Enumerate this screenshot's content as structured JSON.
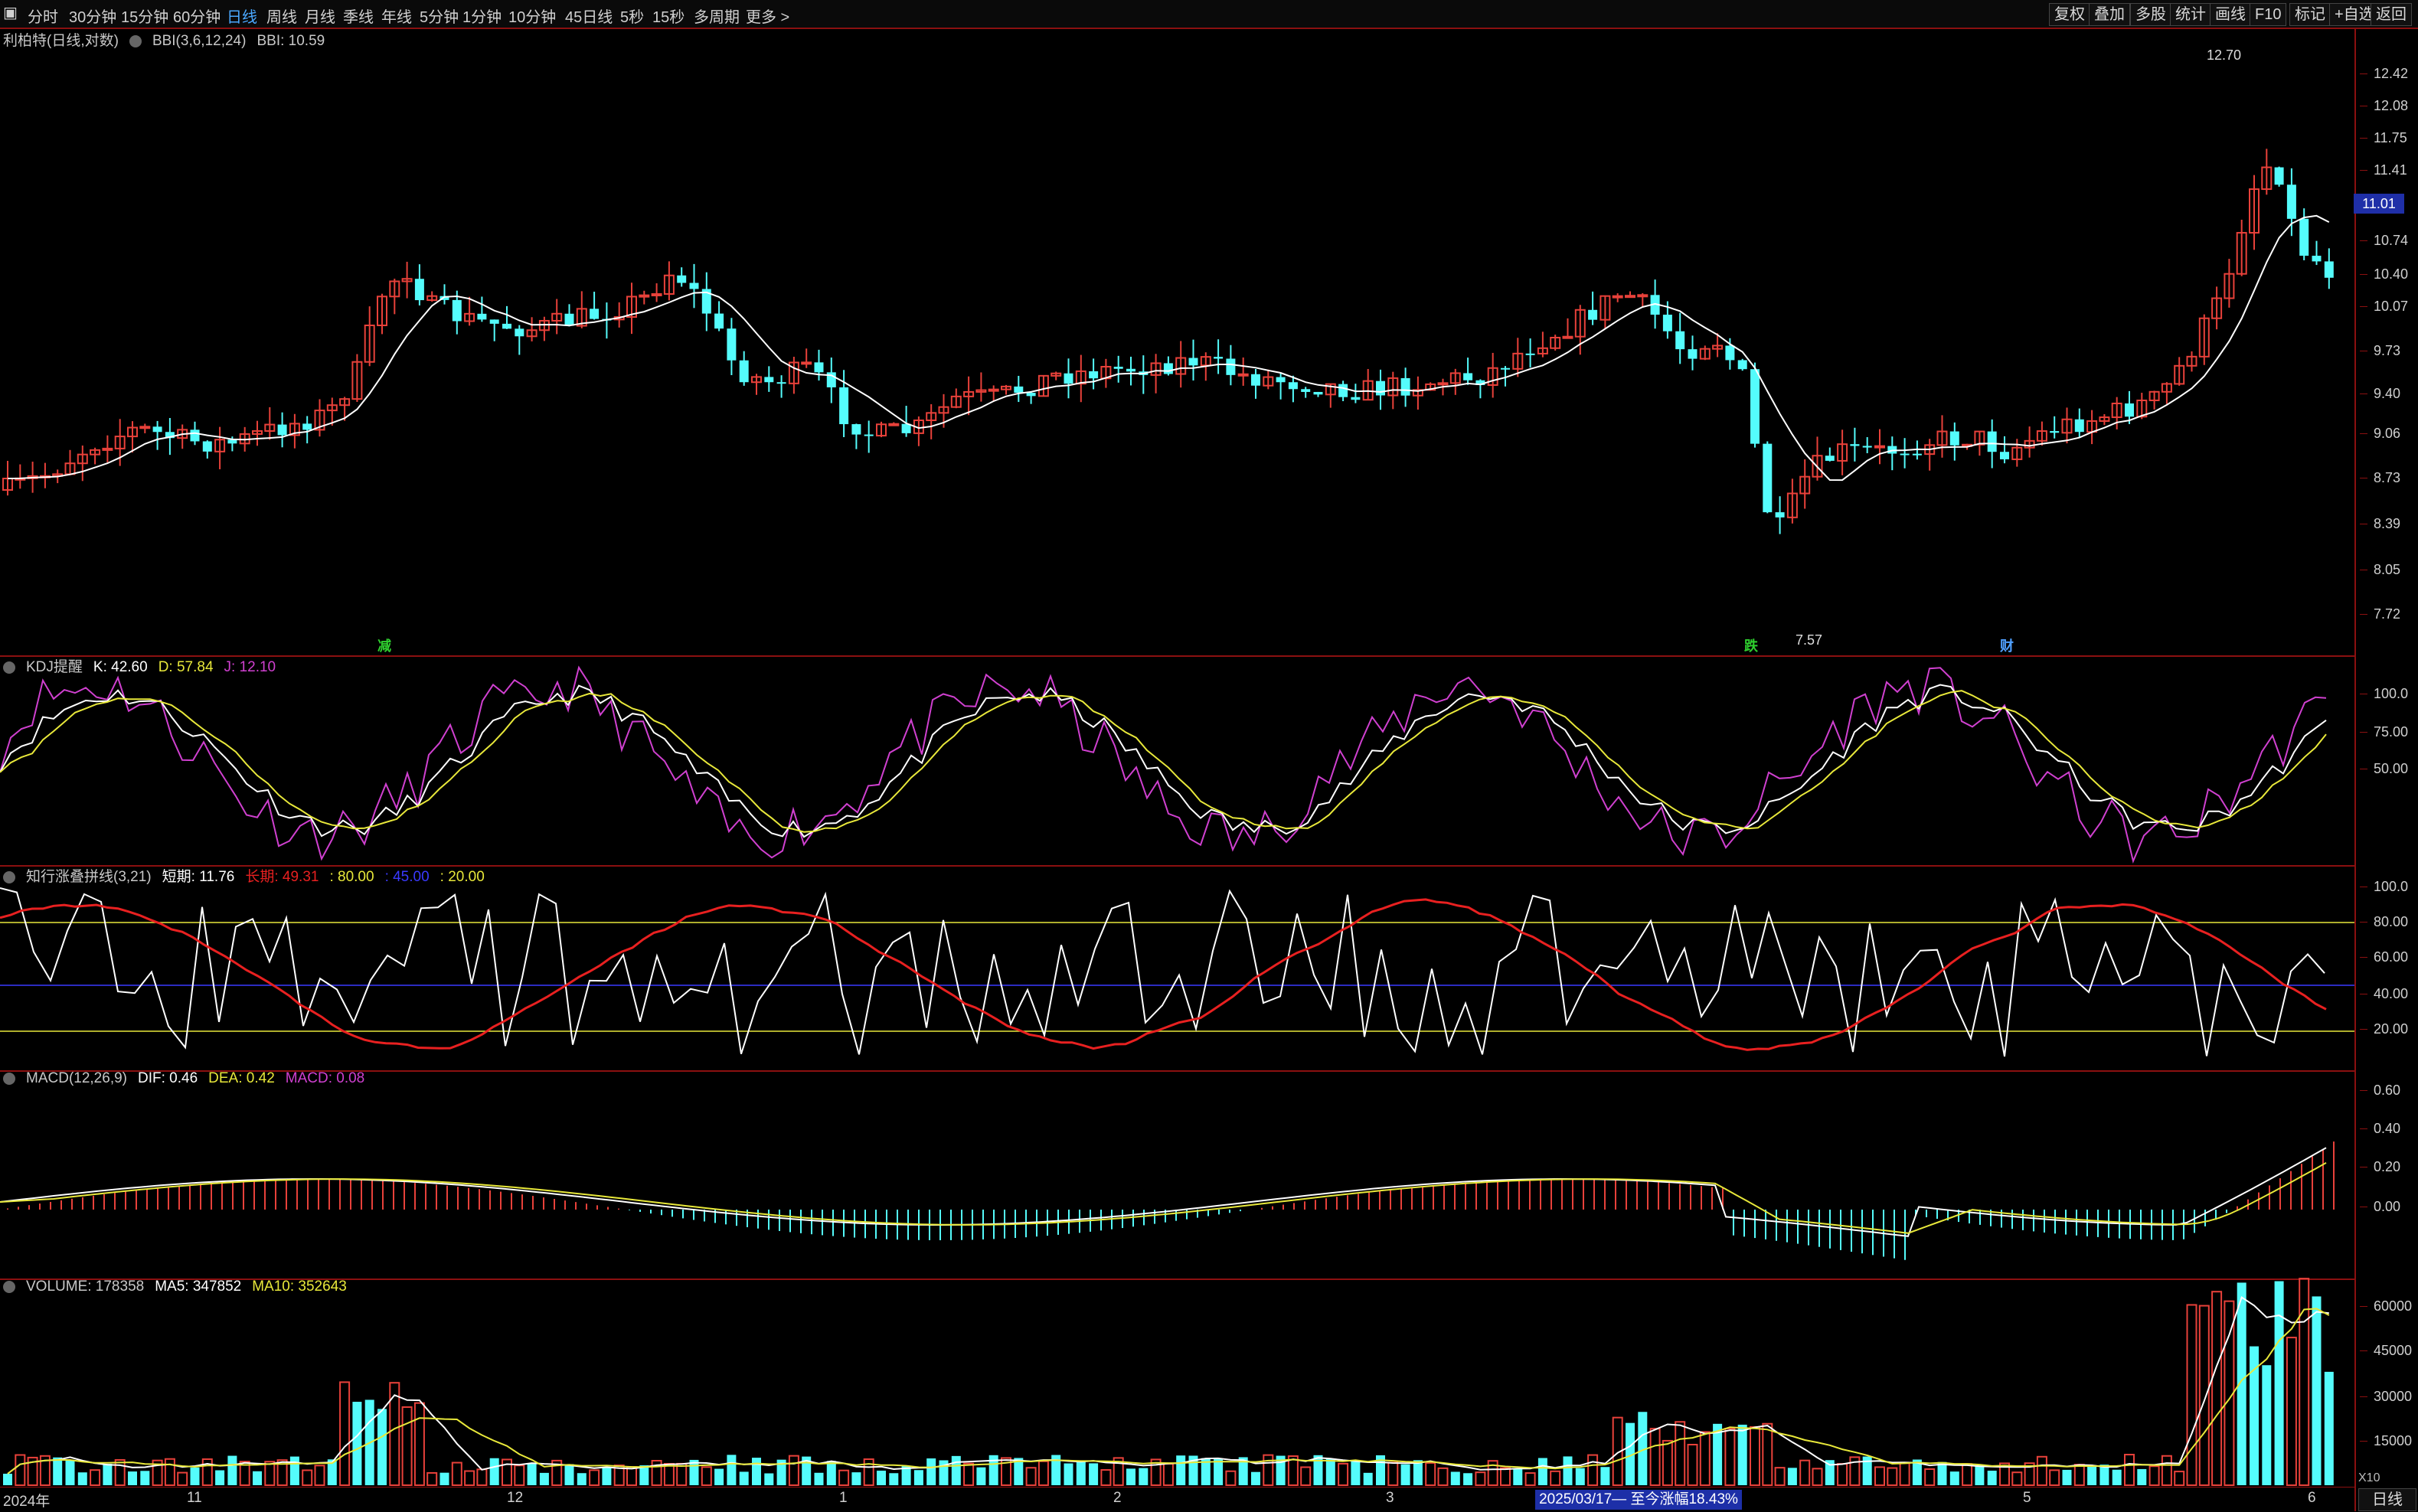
{
  "toolbar": {
    "periods": [
      "分时",
      "30分钟",
      "15分钟",
      "60分钟",
      "日线",
      "周线",
      "月线",
      "季线",
      "年线",
      "5分钟",
      "1分钟",
      "10分钟",
      "45日线",
      "5秒",
      "15秒",
      "多周期",
      "更多 >"
    ],
    "active_period": "日线",
    "right_buttons": [
      "复权",
      "叠加",
      "多股",
      "统计",
      "画线",
      "F10",
      "标记",
      "+自选",
      "返回"
    ]
  },
  "main": {
    "stock_name": "利柏特(日线,对数)",
    "indicator": "BBI(3,6,12,24)",
    "indicator_value": "BBI: 10.59",
    "high_label": "12.70",
    "low_label": "7.57",
    "current_price": "11.01",
    "markers": [
      "减",
      "跌",
      "财"
    ],
    "ticks": [
      "12.42",
      "12.08",
      "11.75",
      "11.41",
      "10.74",
      "10.40",
      "10.07",
      "9.73",
      "9.40",
      "9.06",
      "8.73",
      "8.39",
      "8.05",
      "7.72"
    ]
  },
  "kdj": {
    "title": "KDJ提醒",
    "k": "K: 42.60",
    "d": "D: 57.84",
    "j": "J: 12.10",
    "ticks": [
      "100.0",
      "75.00",
      "50.00"
    ]
  },
  "zx": {
    "title": "知行涨叠拼线(3,21)",
    "short": "短期: 11.76",
    "long": "长期: 49.31",
    "l80": ": 80.00",
    "l45": ": 45.00",
    "l20": ": 20.00",
    "ticks": [
      "100.0",
      "80.00",
      "60.00",
      "40.00",
      "20.00"
    ]
  },
  "macd": {
    "title": "MACD(12,26,9)",
    "dif": "DIF: 0.46",
    "dea": "DEA: 0.42",
    "macd": "MACD: 0.08",
    "ticks": [
      "0.60",
      "0.40",
      "0.20",
      "0.00"
    ]
  },
  "volume": {
    "title": "VOLUME: 178358",
    "ma5": "MA5: 347852",
    "ma10": "MA10: 352643",
    "ticks": [
      "60000",
      "45000",
      "30000",
      "15000"
    ],
    "unit": "X10"
  },
  "xaxis": {
    "labels": [
      "2024年",
      "11",
      "12",
      "1",
      "2",
      "3",
      "5",
      "6"
    ],
    "range_box": "2025/03/17— 至今涨幅18.43%",
    "period": "日线"
  },
  "colors": {
    "up": "#e8413a",
    "down": "#54fcfc",
    "bbi": "#ffffff",
    "k": "#ffffff",
    "d": "#e8e83a",
    "j": "#d040d0",
    "frame": "#8b1010"
  }
}
